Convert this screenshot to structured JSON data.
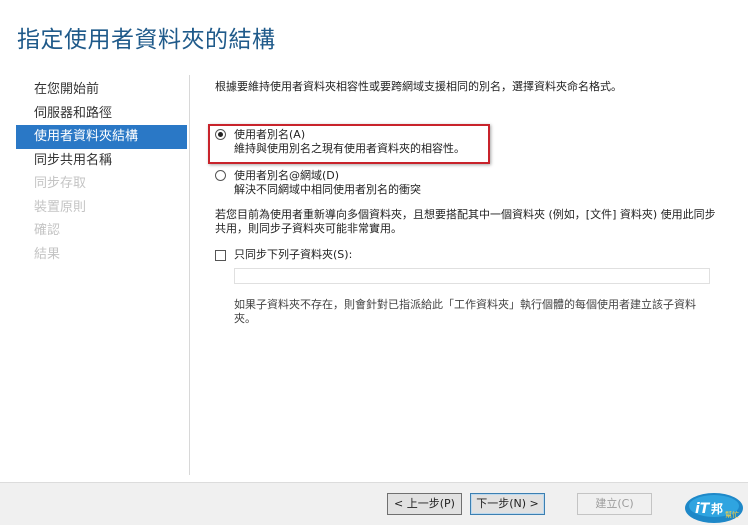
{
  "title": "指定使用者資料夾的結構",
  "sidebar": {
    "steps": [
      {
        "label": "在您開始前"
      },
      {
        "label": "伺服器和路徑"
      },
      {
        "label": "使用者資料夾結構"
      },
      {
        "label": "同步共用名稱"
      },
      {
        "label": "同步存取"
      },
      {
        "label": "裝置原則"
      },
      {
        "label": "確認"
      },
      {
        "label": "結果"
      }
    ],
    "active_index": 2
  },
  "content": {
    "intro": "根據要維持使用者資料夾相容性或要跨網域支援相同的別名，選擇資料夾命名格式。",
    "options": [
      {
        "label": "使用者別名(A)",
        "description": "維持與使用別名之現有使用者資料夾的相容性。",
        "selected": true
      },
      {
        "label": "使用者別名@網域(D)",
        "description": "解決不同網域中相同使用者別名的衝突",
        "selected": false
      }
    ],
    "note": "若您目前為使用者重新導向多個資料夾，且想要搭配其中一個資料夾 (例如，[文件] 資料夾) 使用此同步共用，則同步子資料夾可能非常實用。",
    "checkbox": {
      "label": "只同步下列子資料夾(S):",
      "checked": false
    },
    "subfolder_value": "",
    "sub_note": "如果子資料夾不存在，則會針對已指派給此「工作資料夾」執行個體的每個使用者建立該子資料夾。"
  },
  "buttons": {
    "prev": "< 上一步(P)",
    "next": "下一步(N) >",
    "create": "建立(C)"
  },
  "watermark": {
    "text": "iT邦幫忙"
  },
  "colors": {
    "title": "#1f5a8a",
    "active_step_bg": "#2a78c6",
    "highlight_border": "#c8232b"
  }
}
